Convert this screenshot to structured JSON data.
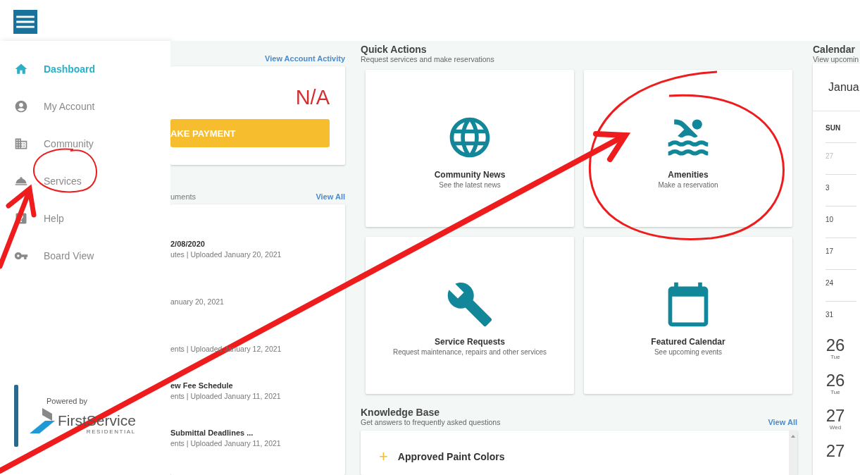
{
  "sidebar": {
    "items": [
      {
        "label": "Dashboard",
        "selected": true
      },
      {
        "label": "My Account",
        "selected": false
      },
      {
        "label": "Community",
        "selected": false
      },
      {
        "label": "Services",
        "selected": false
      },
      {
        "label": "Help",
        "selected": false
      },
      {
        "label": "Board View",
        "selected": false
      }
    ],
    "logo": {
      "caption": "Powered by",
      "name": "FirstService",
      "tagline": "RESIDENTIAL"
    }
  },
  "account": {
    "link": "View Account Activity",
    "balance": "N/A",
    "button": "AKE PAYMENT"
  },
  "documents": {
    "title": "uments",
    "link": "View All",
    "items": [
      {
        "title": "2/08/2020",
        "meta": "utes | Uploaded January 20, 2021"
      },
      {
        "meta": "anuary 20, 2021"
      },
      {
        "meta": "ents | Uploaded January 12, 2021"
      },
      {
        "title": "ew Fee Schedule",
        "meta": "ents | Uploaded January 11, 2021"
      },
      {
        "title": "Submittal Deadlines ...",
        "meta": "ents | Uploaded January 11, 2021"
      }
    ]
  },
  "quick_actions": {
    "title": "Quick Actions",
    "subtitle": "Request services and make reservations",
    "cards": [
      {
        "title": "Community News",
        "subtitle": "See the latest news"
      },
      {
        "title": "Amenities",
        "subtitle": "Make a reservation"
      },
      {
        "title": "Service Requests",
        "subtitle": "Request maintenance, repairs and other services"
      },
      {
        "title": "Featured Calendar",
        "subtitle": "See upcoming events"
      }
    ]
  },
  "knowledge_base": {
    "title": "Knowledge Base",
    "subtitle": "Get answers to frequently asked questions",
    "link": "View All",
    "items": [
      {
        "marker": "+",
        "title": "Approved Paint Colors"
      }
    ]
  },
  "calendar": {
    "title": "Calendar",
    "subtitle": "View upcomin",
    "month": "Janua",
    "weekday": "SUN",
    "days": [
      {
        "label": "27",
        "muted": true
      },
      {
        "label": "3",
        "muted": false
      },
      {
        "label": "10",
        "muted": false
      },
      {
        "label": "17",
        "muted": false
      },
      {
        "label": "24",
        "muted": false
      },
      {
        "label": "31",
        "muted": false
      }
    ],
    "events": [
      {
        "day": "26",
        "weekday": "Tue"
      },
      {
        "day": "26",
        "weekday": "Tue"
      },
      {
        "day": "27",
        "weekday": "Wed"
      },
      {
        "day": "27"
      }
    ]
  }
}
